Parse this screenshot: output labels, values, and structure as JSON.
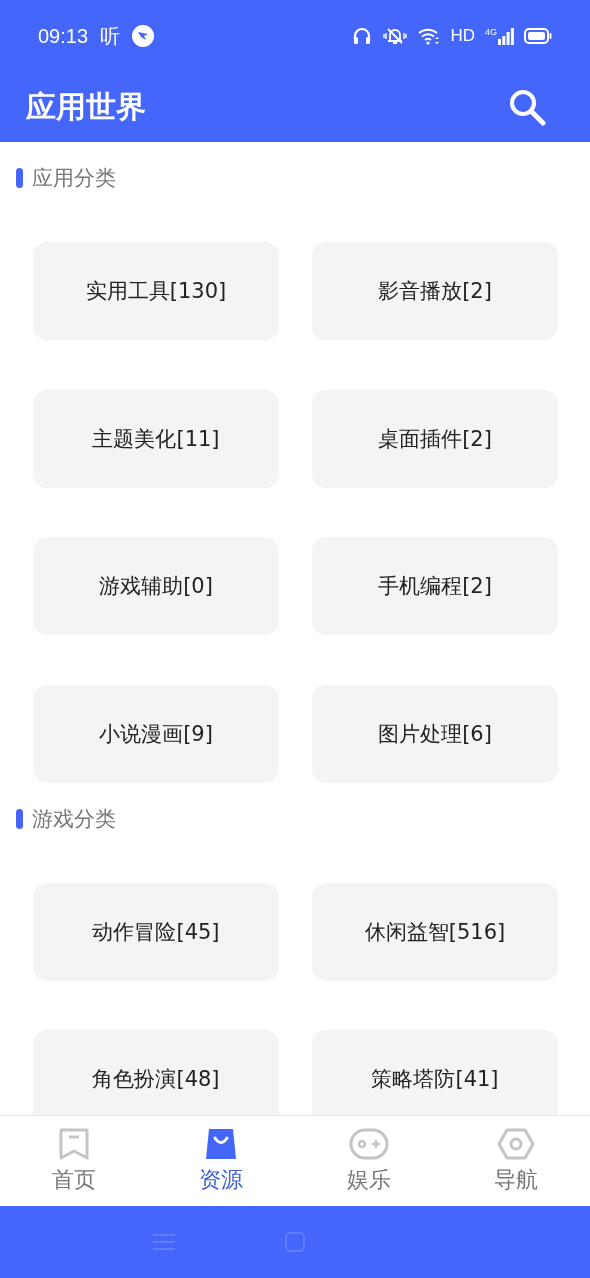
{
  "status_bar": {
    "time": "09:13",
    "app_badge": "听",
    "network_label": "HD",
    "cell_label": "4G"
  },
  "app_bar": {
    "title": "应用世界"
  },
  "sections": [
    {
      "title": "应用分类",
      "items": [
        {
          "label": "实用工具[130]"
        },
        {
          "label": "影音播放[2]"
        },
        {
          "label": "主题美化[11]"
        },
        {
          "label": "桌面插件[2]"
        },
        {
          "label": "游戏辅助[0]"
        },
        {
          "label": "手机编程[2]"
        },
        {
          "label": "小说漫画[9]"
        },
        {
          "label": "图片处理[6]"
        }
      ]
    },
    {
      "title": "游戏分类",
      "items": [
        {
          "label": "动作冒险[45]"
        },
        {
          "label": "休闲益智[516]"
        },
        {
          "label": "角色扮演[48]"
        },
        {
          "label": "策略塔防[41]"
        }
      ]
    }
  ],
  "bottom_nav": [
    {
      "label": "首页",
      "kind": "bookmark",
      "selected": false
    },
    {
      "label": "资源",
      "kind": "bag",
      "selected": true
    },
    {
      "label": "娱乐",
      "kind": "gamepad",
      "selected": false
    },
    {
      "label": "导航",
      "kind": "nut",
      "selected": false
    }
  ]
}
